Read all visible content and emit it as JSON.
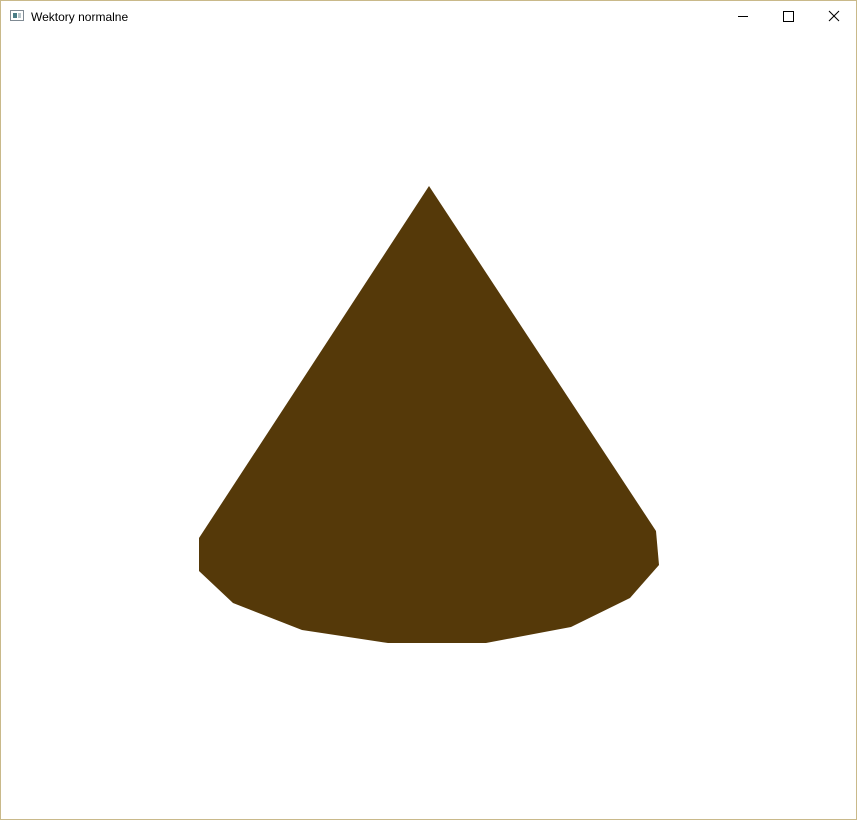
{
  "window": {
    "title": "Wektory normalne",
    "border_color": "#c9b98a"
  },
  "titlebar": {
    "icons": {
      "app": "app-window-icon",
      "minimize": "minimize-icon",
      "maximize": "maximize-icon",
      "close": "close-icon"
    }
  },
  "scene": {
    "object": "cone",
    "fill_color": "#553909",
    "background_color": "#ffffff"
  }
}
